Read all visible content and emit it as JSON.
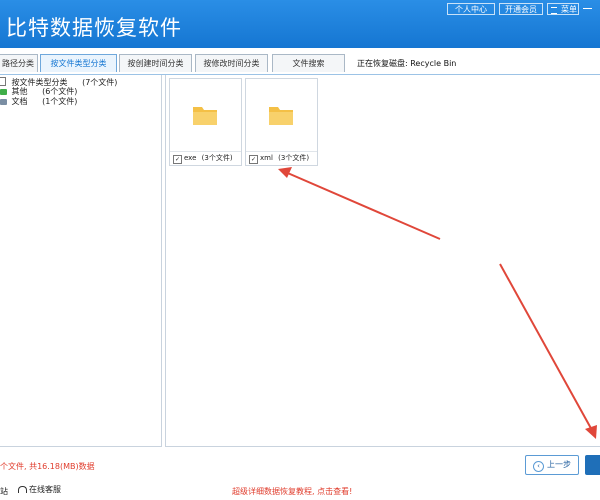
{
  "app": {
    "title": "比特数据恢复软件"
  },
  "top_buttons": [
    "个人中心",
    "开通会员",
    "菜单"
  ],
  "tabs": [
    "路径分类",
    "按文件类型分类",
    "按创建时间分类",
    "按修改时间分类",
    "文件搜索"
  ],
  "active_tab": "按文件类型分类",
  "recovery_status": "正在恢复磁盘: Recycle Bin",
  "tree": {
    "root": {
      "label": "按文件类型分类",
      "count": "(7个文件)"
    },
    "items": [
      {
        "label": "其他",
        "count": "(6个文件)"
      },
      {
        "label": "文档",
        "count": "(1个文件)"
      }
    ]
  },
  "tiles": [
    {
      "name": "exe",
      "count": "(3个文件)"
    },
    {
      "name": "xml",
      "count": "(3个文件)"
    }
  ],
  "footer": {
    "summary": "个文件, 共16.18(MB)数据",
    "prev_button": "上一步",
    "left_partial": "站",
    "support": "在线客服",
    "tutorial_link": "超级详细数据恢复教程, 点击查看!"
  },
  "colors": {
    "titlebar": "#1a7fd9",
    "accent": "#1576d2",
    "annotation_red": "#e0473a",
    "folder": "#f6c95d"
  }
}
